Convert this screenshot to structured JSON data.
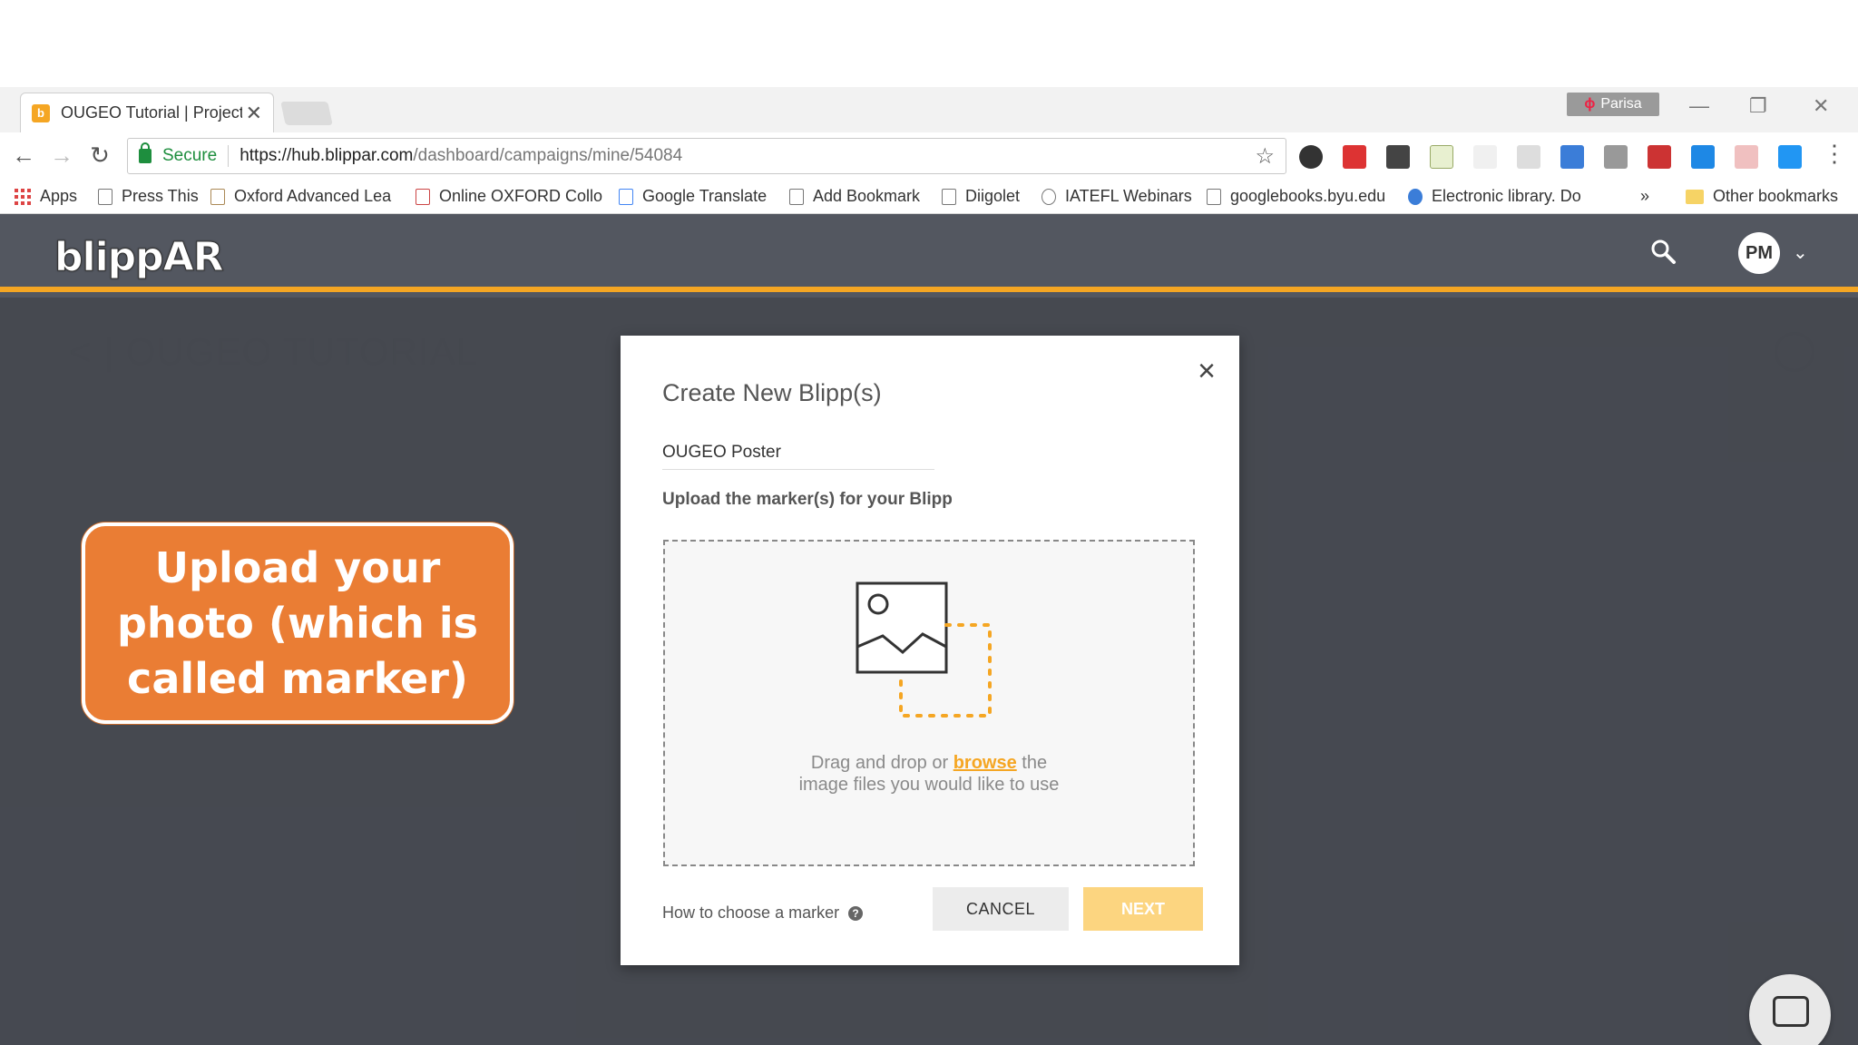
{
  "browser": {
    "tab_title": "OUGEO Tutorial | Project",
    "tab_favicon": "b",
    "profile_name": "Parisa",
    "url_secure_label": "Secure",
    "url_host": "https://hub.blippar.com",
    "url_path": "/dashboard/campaigns/mine/54084",
    "bookmarks": [
      {
        "label": "Apps",
        "icon": "apps-grid-icon"
      },
      {
        "label": "Press This",
        "icon": "page-icon"
      },
      {
        "label": "Oxford Advanced Lea",
        "icon": "oxford-icon"
      },
      {
        "label": "Online OXFORD Collo",
        "icon": "oxford-collocations-icon"
      },
      {
        "label": "Google Translate",
        "icon": "translate-icon"
      },
      {
        "label": "Add Bookmark",
        "icon": "page-icon"
      },
      {
        "label": "Diigolet",
        "icon": "page-icon"
      },
      {
        "label": "IATEFL Webinars",
        "icon": "iatefl-icon"
      },
      {
        "label": "googlebooks.byu.edu",
        "icon": "page-icon"
      },
      {
        "label": "Electronic library. Do",
        "icon": "globe-icon"
      }
    ],
    "bookmarks_overflow": "»",
    "other_bookmarks": "Other bookmarks"
  },
  "app": {
    "logo": "blippAR",
    "avatar_initials": "PM",
    "page_title": "< | OUGEO TUTORIAL",
    "accent_color": "#f5a623"
  },
  "modal": {
    "title": "Create New Blipp(s)",
    "name_value": "OUGEO Poster",
    "upload_label": "Upload the marker(s) for your Blipp",
    "dropzone_text_before": "Drag and drop or ",
    "dropzone_link": "browse",
    "dropzone_text_after": " the",
    "dropzone_text_line2": "image files you would like to use",
    "how_to_link": "How to choose a marker",
    "cancel_label": "CANCEL",
    "next_label": "NEXT"
  },
  "callout": {
    "text": "Upload your photo (which is called marker)"
  }
}
